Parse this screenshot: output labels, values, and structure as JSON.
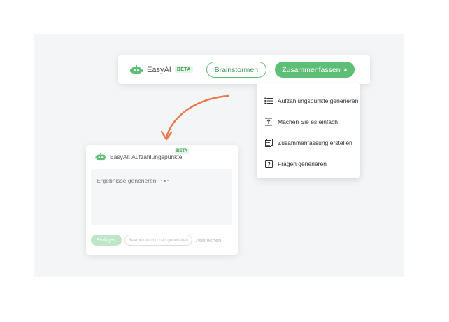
{
  "toolbar": {
    "brand": "EasyAI",
    "beta": "BETA",
    "brainstorm_label": "Brainstormen",
    "summarize_label": "Zusammenfassen",
    "summarize_caret": "^",
    "icon": "robot-icon"
  },
  "menu": {
    "items": [
      {
        "label": "Aufzählungspunkte generieren",
        "icon": "bulleted-list-icon"
      },
      {
        "label": "Machen Sie es einfach",
        "icon": "simplify-icon"
      },
      {
        "label": "Zusammenfassung erstellen",
        "icon": "document-summary-icon"
      },
      {
        "label": "Fragen generieren",
        "icon": "question-box-icon"
      }
    ]
  },
  "panel": {
    "title": "EasyAI: Aufzählungspunkte",
    "beta": "BETA",
    "status": "Ergebnisse generieren",
    "insert_label": "Einfügen",
    "edit_regenerate_label": "Bearbeiten und neu generieren",
    "cancel_label": "Abbrechen"
  },
  "colors": {
    "accent": "#5cbf75",
    "accent_dark": "#3f9a57",
    "arrow": "#e8794a",
    "stage_bg": "#f4f5f6"
  }
}
